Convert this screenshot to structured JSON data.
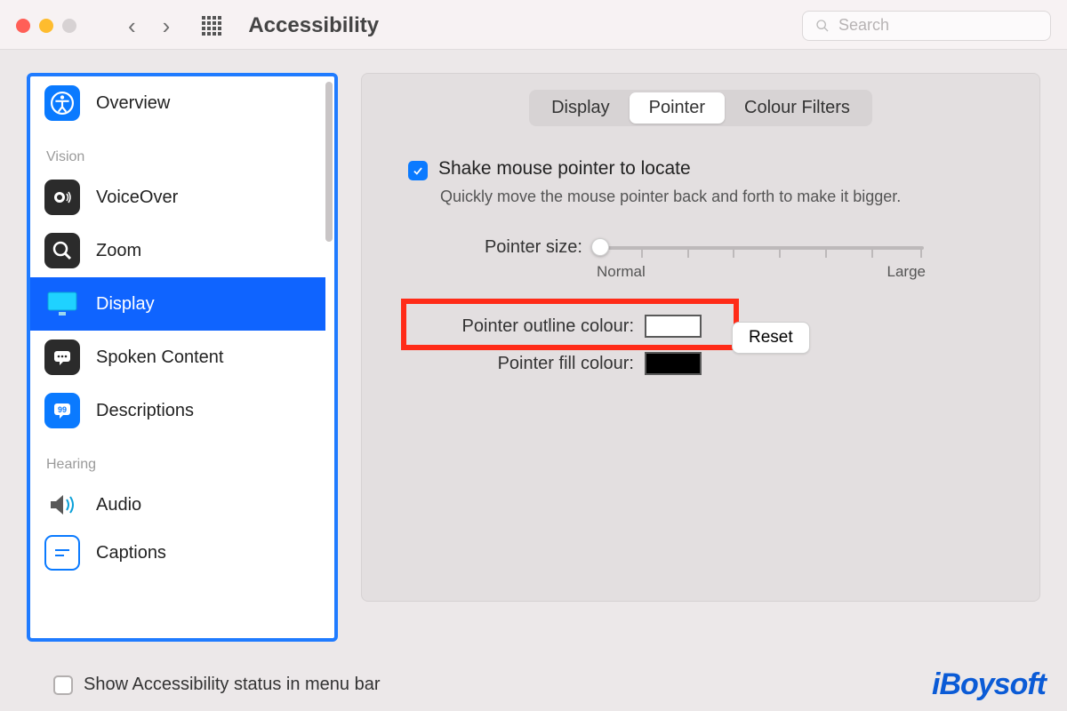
{
  "toolbar": {
    "title": "Accessibility",
    "search_placeholder": "Search"
  },
  "sidebar": {
    "items": [
      {
        "label": "Overview",
        "icon": "accessibility-icon"
      }
    ],
    "sections": [
      {
        "title": "Vision",
        "items": [
          {
            "label": "VoiceOver",
            "icon": "voiceover-icon"
          },
          {
            "label": "Zoom",
            "icon": "zoom-icon"
          },
          {
            "label": "Display",
            "icon": "display-icon",
            "selected": true
          },
          {
            "label": "Spoken Content",
            "icon": "spoken-content-icon"
          },
          {
            "label": "Descriptions",
            "icon": "descriptions-icon"
          }
        ]
      },
      {
        "title": "Hearing",
        "items": [
          {
            "label": "Audio",
            "icon": "audio-icon"
          },
          {
            "label": "Captions",
            "icon": "captions-icon"
          }
        ]
      }
    ]
  },
  "tabs": {
    "items": [
      "Display",
      "Pointer",
      "Colour Filters"
    ],
    "active": "Pointer"
  },
  "pointer": {
    "shake_label": "Shake mouse pointer to locate",
    "shake_desc": "Quickly move the mouse pointer back and forth to make it bigger.",
    "shake_checked": true,
    "size_label": "Pointer size:",
    "size_min_label": "Normal",
    "size_max_label": "Large",
    "outline_label": "Pointer outline colour:",
    "fill_label": "Pointer fill colour:",
    "outline_color": "#ffffff",
    "fill_color": "#000000",
    "reset_label": "Reset"
  },
  "footer": {
    "status_label": "Show Accessibility status in menu bar",
    "status_checked": false
  },
  "watermark": "iBoysoft"
}
